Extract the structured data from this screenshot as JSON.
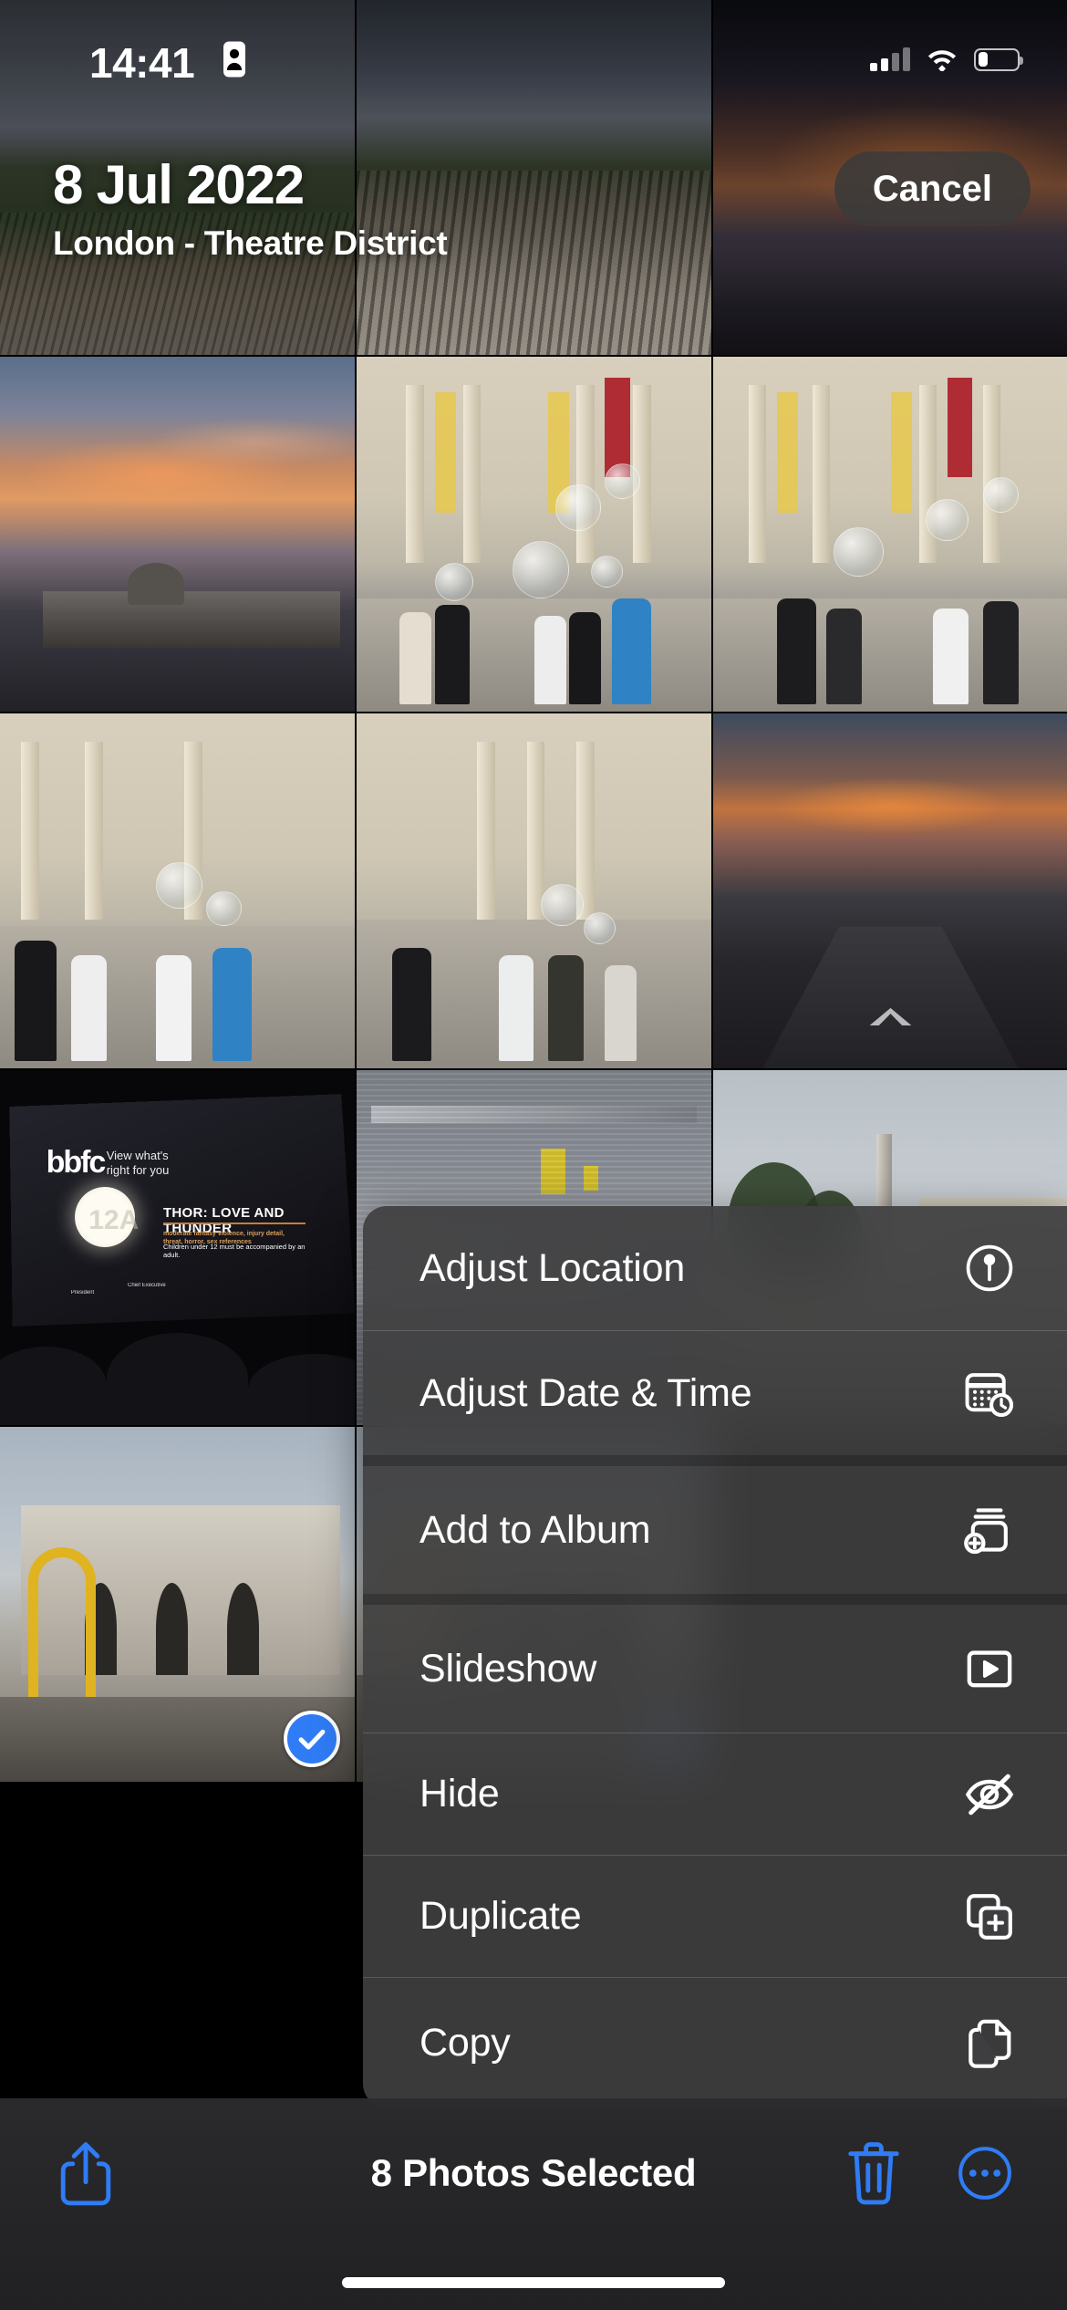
{
  "status_bar": {
    "time": "14:41",
    "location_icon": "location-services-icon",
    "cellular_icon": "cellular-signal-icon",
    "cellular_bars_filled": 2,
    "cellular_bars_total": 4,
    "wifi_icon": "wifi-icon",
    "battery_icon": "battery-low-icon",
    "battery_level_percent": 22
  },
  "header": {
    "date_title": "8 Jul 2022",
    "place_title": "London - Theatre District",
    "cancel_label": "Cancel"
  },
  "context_menu": {
    "items": [
      {
        "label": "Adjust Location",
        "icon": "location-pin-circle-icon"
      },
      {
        "label": "Adjust Date & Time",
        "icon": "calendar-clock-icon"
      },
      {
        "label": "Add to Album",
        "icon": "rectangle-stack-plus-icon"
      },
      {
        "label": "Slideshow",
        "icon": "play-rectangle-icon"
      },
      {
        "label": "Hide",
        "icon": "eye-slash-icon"
      },
      {
        "label": "Duplicate",
        "icon": "plus-square-on-square-icon"
      },
      {
        "label": "Copy",
        "icon": "doc-on-doc-icon"
      }
    ]
  },
  "toolbar": {
    "share_icon": "share-icon",
    "selection_text": "8 Photos Selected",
    "trash_icon": "trash-icon",
    "more_icon": "ellipsis-circle-icon"
  },
  "colors": {
    "accent_blue": "#2f7cf6",
    "tint_blue": "#2f7cf6",
    "menu_background": "#3e3e40",
    "toolbar_background": "#2e2e30",
    "text_primary": "#ffffff"
  },
  "grid": {
    "columns": 3,
    "selected_count": 8,
    "photos": [
      {
        "name": "railway-cutting-cloudy",
        "art": "p-rail-a",
        "selected": false
      },
      {
        "name": "railway-tracks-gravel",
        "art": "p-rail-b",
        "selected": false
      },
      {
        "name": "trafalgar-square-dusk",
        "art": "p-dusk",
        "selected": false
      },
      {
        "name": "sunset-over-national-gallery",
        "art": "p-sunset1",
        "selected": false
      },
      {
        "name": "bubbles-crowd-gallery-a",
        "art": "p-gallery",
        "selected": false
      },
      {
        "name": "bubbles-crowd-gallery-b",
        "art": "p-gallery",
        "selected": false
      },
      {
        "name": "bubbles-crowd-gallery-c",
        "art": "p-gallery",
        "selected": false
      },
      {
        "name": "bubbles-crowd-gallery-d",
        "art": "p-gallery",
        "selected": false
      },
      {
        "name": "street-sunset-london",
        "art": "p-street",
        "selected": false
      },
      {
        "name": "cinema-bbfc-thor-screen",
        "art": "p-cinema",
        "selected": false
      },
      {
        "name": "industrial-machinery",
        "art": "p-factory",
        "selected": false
      },
      {
        "name": "nelsons-column-street",
        "art": "p-column",
        "selected": false
      },
      {
        "name": "admiralty-arch-day",
        "art": "p-arch",
        "selected": true
      },
      {
        "name": "admiralty-arch-evening",
        "art": "p-arch",
        "selected": true
      }
    ],
    "cinema_photo": {
      "brand": "bbfc",
      "tagline_line1": "View what's",
      "tagline_line2": "right for you",
      "rating": "12A",
      "film_title": "THOR: LOVE AND THUNDER",
      "advice_line1": "moderate fantasy violence, injury detail, threat, horror, sex references",
      "advice_line2": "Children under 12 must be accompanied by an adult.",
      "signature_role_1": "President",
      "signature_role_2": "Chief Executive"
    }
  }
}
